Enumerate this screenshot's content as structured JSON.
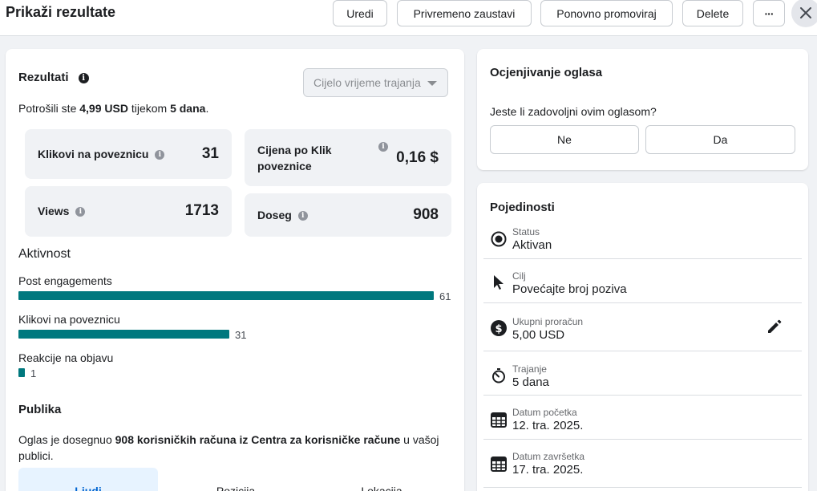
{
  "header": {
    "title": "Prikaži rezultate",
    "buttons": {
      "edit": "Uredi",
      "pause": "Privremeno zaustavi",
      "promote_again": "Ponovno promoviraj",
      "delete": "Delete",
      "more": "···"
    }
  },
  "results": {
    "title": "Rezultati",
    "timeframe_placeholder": "Cijelo vrijeme trajanja",
    "spent_prefix": "Potrošili ste ",
    "spent_amount": "4,99 USD",
    "spent_middle": " tijekom ",
    "spent_days": "5 dana",
    "spent_suffix": ".",
    "stats": [
      {
        "label": "Klikovi na poveznicu",
        "value": "31"
      },
      {
        "label": "Cijena po Klik poveznice",
        "value": "0,16 $"
      },
      {
        "label": "Views",
        "value": "1713"
      },
      {
        "label": "Doseg",
        "value": "908"
      }
    ]
  },
  "activity": {
    "title": "Aktivnost",
    "items": [
      {
        "label": "Post engagements",
        "value": "61",
        "fraction": 1.0
      },
      {
        "label": "Klikovi na poveznicu",
        "value": "31",
        "fraction": 0.508
      },
      {
        "label": "Reakcije na objavu",
        "value": "1",
        "fraction": 0.016
      }
    ],
    "bar_color": "#00787e"
  },
  "audience": {
    "title": "Publika",
    "text_prefix": "Oglas je dosegnuo ",
    "text_bold": "908 korisničkih računa iz Centra za korisničke račune",
    "text_suffix_1": " u vašoj",
    "text_suffix_2": "publici.",
    "tabs": [
      "Ljudi",
      "Pozicija",
      "Lokacija"
    ]
  },
  "rating": {
    "title": "Ocjenjivanje oglasa",
    "question": "Jeste li zadovoljni ovim oglasom?",
    "no": "Ne",
    "yes": "Da"
  },
  "details": {
    "title": "Pojedinosti",
    "rows": [
      {
        "label": "Status",
        "value": "Aktivan",
        "icon": "radio-selected-icon"
      },
      {
        "label": "Cilj",
        "value": "Povećajte broj poziva",
        "icon": "cursor-icon"
      },
      {
        "label": "Ukupni proračun",
        "value": "5,00 USD",
        "icon": "dollar-icon"
      },
      {
        "label": "Trajanje",
        "value": "5 dana",
        "icon": "stopwatch-icon"
      },
      {
        "label": "Datum početka",
        "value": "12. tra. 2025.",
        "icon": "calendar-icon"
      },
      {
        "label": "Datum završetka",
        "value": "17. tra. 2025.",
        "icon": "calendar-icon"
      }
    ]
  },
  "colors": {
    "accent": "#00787e",
    "selected_tab_bg": "#e7f3ff",
    "selected_tab_text": "#0064d1"
  }
}
